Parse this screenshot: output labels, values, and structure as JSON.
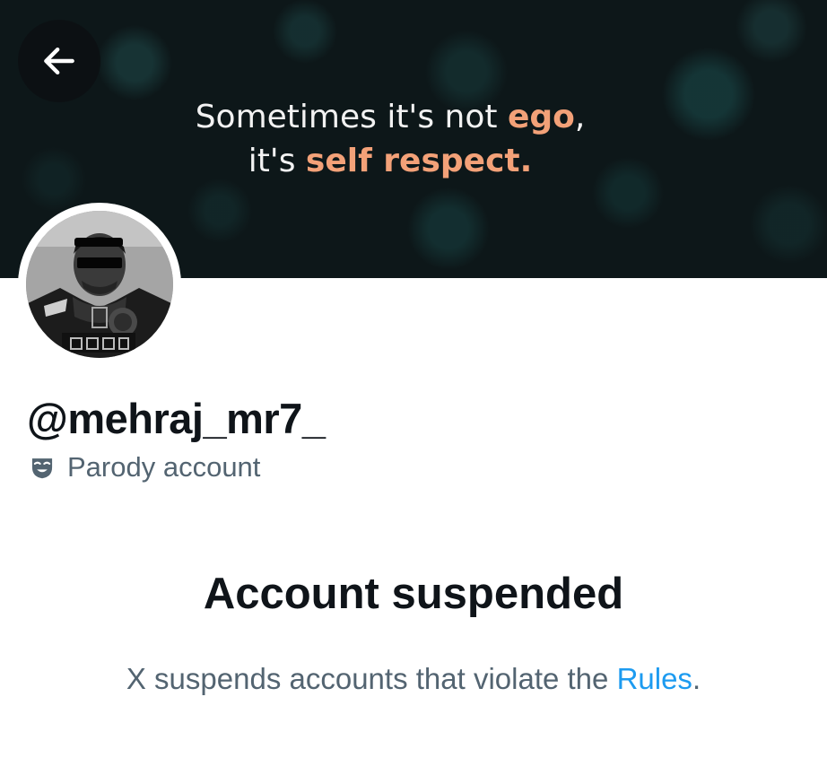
{
  "banner": {
    "line1_prefix": "Sometimes it's not ",
    "line1_highlight": "ego",
    "line1_suffix": ",",
    "line2_prefix": "it's ",
    "line2_highlight": "self respect",
    "line2_suffix": "."
  },
  "navigation": {
    "back_icon": "arrow-left-icon"
  },
  "profile": {
    "avatar_icon": "profile-photo",
    "handle": "@mehraj_mr7_",
    "label_icon": "drama-mask-icon",
    "label_text": "Parody account"
  },
  "suspension": {
    "title": "Account suspended",
    "description_prefix": "X suspends accounts that violate the ",
    "rules_link": "Rules",
    "description_suffix": "."
  },
  "colors": {
    "text_primary": "#0f1419",
    "text_secondary": "#536471",
    "link": "#1d9bf0",
    "banner_highlight": "#f3a178",
    "banner_background": "#0d1719"
  }
}
